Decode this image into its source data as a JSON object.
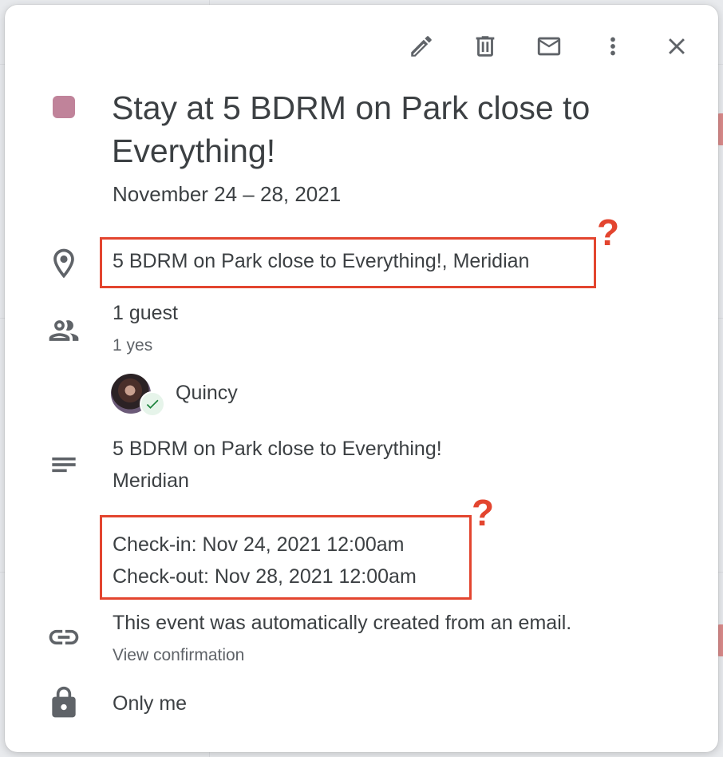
{
  "toolbar": {
    "edit_icon": "pencil-icon",
    "delete_icon": "trash-icon",
    "email_icon": "mail-icon",
    "more_icon": "more-vert-icon",
    "close_icon": "close-icon"
  },
  "event": {
    "color": "#c0839a",
    "title": "Stay at 5 BDRM on Park close to Everything!",
    "date_range": "November 24 – 28, 2021",
    "location": "5 BDRM on Park close to Everything!, Meridian",
    "guests": {
      "count_label": "1 guest",
      "rsvp_summary": "1 yes",
      "list": [
        {
          "name": "Quincy",
          "status": "yes"
        }
      ]
    },
    "description": {
      "line1": "5 BDRM on Park close to Everything!",
      "line2": "Meridian",
      "check_in": "Check-in: Nov 24, 2021 12:00am",
      "check_out": "Check-out: Nov 28, 2021 12:00am"
    },
    "auto_created_text": "This event was automatically created from an email.",
    "view_confirmation_label": "View confirmation",
    "visibility": "Only me"
  },
  "annotations": {
    "color": "#e3452f",
    "mark": "?"
  }
}
